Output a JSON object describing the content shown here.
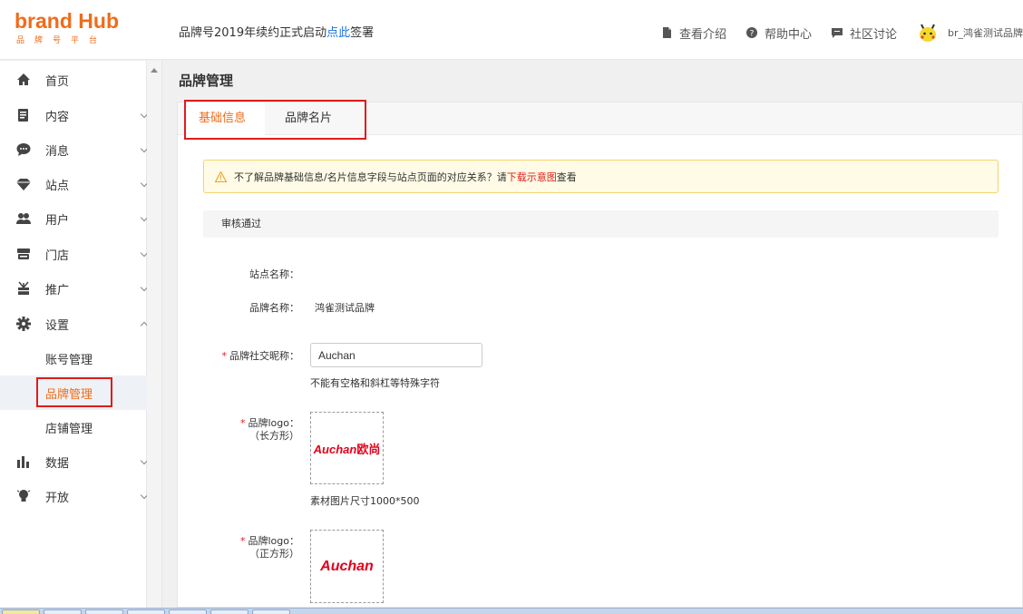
{
  "logo": {
    "main": "brand Hub",
    "sub": "品牌号平台"
  },
  "announcement": {
    "before": "品牌号2019年续约正式启动",
    "link": "点此",
    "after": "签署"
  },
  "topnav": {
    "items": [
      {
        "label": "查看介绍",
        "icon": "document-icon"
      },
      {
        "label": "帮助中心",
        "icon": "help-icon"
      },
      {
        "label": "社区讨论",
        "icon": "chat-icon"
      }
    ],
    "user": "br_鸿雀测试品牌"
  },
  "sidebar": {
    "items": [
      {
        "label": "首页",
        "icon": "home-icon"
      },
      {
        "label": "内容",
        "icon": "content-icon"
      },
      {
        "label": "消息",
        "icon": "message-icon"
      },
      {
        "label": "站点",
        "icon": "diamond-icon"
      },
      {
        "label": "用户",
        "icon": "users-icon"
      },
      {
        "label": "门店",
        "icon": "store-icon"
      },
      {
        "label": "推广",
        "icon": "promote-icon"
      },
      {
        "label": "设置",
        "icon": "gear-icon"
      },
      {
        "label": "数据",
        "icon": "chart-icon"
      },
      {
        "label": "开放",
        "icon": "bulb-icon"
      }
    ],
    "settings_sub": [
      {
        "label": "账号管理"
      },
      {
        "label": "品牌管理"
      },
      {
        "label": "店铺管理"
      }
    ]
  },
  "page": {
    "title": "品牌管理",
    "tabs": [
      {
        "label": "基础信息"
      },
      {
        "label": "品牌名片"
      }
    ],
    "alert": {
      "before": "不了解品牌基础信息/名片信息字段与站点页面的对应关系？请",
      "link": "下载示意图",
      "after": "查看"
    },
    "status": "审核通过",
    "form": {
      "site_name_label": "站点名称：",
      "site_name_value": "",
      "brand_name_label": "品牌名称：",
      "brand_name_value": "鸿雀测试品牌",
      "social_label": "品牌社交昵称：",
      "social_value": "Auchan",
      "social_hint": "不能有空格和斜杠等特殊字符",
      "logo_rect_label": "品牌logo：",
      "logo_rect_sub": "（长方形）",
      "logo_rect_hint": "素材图片尺寸1000*500",
      "logo_square_label": "品牌logo：",
      "logo_square_sub": "（正方形）",
      "required_mark": "*"
    },
    "brand_logo": {
      "latin": "Auchan",
      "cn": "欧尚"
    }
  },
  "colors": {
    "accent": "#ef6c1a",
    "required": "#e01b1b",
    "link": "#1a73e8",
    "logo_red": "#e2001a"
  }
}
